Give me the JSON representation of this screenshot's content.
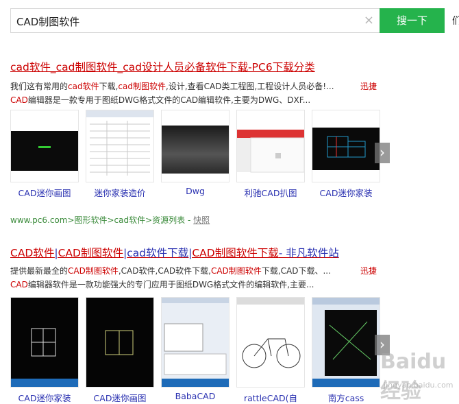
{
  "search": {
    "query": "CAD制图软件",
    "clear_glyph": "×",
    "button_label": "搜一下",
    "edge_fragment": "们"
  },
  "results": [
    {
      "title_parts": [
        "cad软件_cad制图软件_cad设计人员必备软件下载-PC6下载分类"
      ],
      "snippet1_parts": [
        "我们这有常用的",
        "cad软件",
        "下载,",
        "cad制图软件",
        ",设计,查看CAD类工程图,工程设计人员必备!..."
      ],
      "snippet2_parts": [
        "CAD",
        "编辑器是一款专用于图纸DWG格式文件的CAD编辑软件,主要为DWG、DXF..."
      ],
      "more_label": "迅捷",
      "thumbs": [
        "CAD迷你画图",
        "迷你家装造价",
        "Dwg",
        "利驰CAD扒图",
        "CAD迷你家装"
      ],
      "url_text": "www.pc6.com>图形软件>cad软件>资源列表 - ",
      "snapshot_label": "快照"
    },
    {
      "title_parts": [
        "CAD软件",
        "|",
        "CAD制图软件",
        "|",
        "cad软件下载",
        "|",
        "CAD制图软件下载",
        "- 非凡软件站"
      ],
      "snippet1_parts": [
        "提供最新最全的",
        "CAD制图软件",
        ",CAD软件,CAD软件下载,",
        "CAD制图软件",
        "下载,CAD下载、..."
      ],
      "snippet2_parts": [
        "CAD",
        "编辑器软件是一款功能强大的专门应用于图纸DWG格式文件的编辑软件,主要..."
      ],
      "more_label": "迅捷",
      "thumbs": [
        "CAD迷你家装",
        "CAD迷你画图",
        "BabaCAD",
        "rattleCAD(自",
        "南方cass"
      ]
    }
  ],
  "watermark": {
    "text": "Baidu经验",
    "url": "jingyan.baidu.com"
  },
  "colors": {
    "accent_green": "#25b34c",
    "link_red": "#cc0000",
    "link_blue": "#2a31b1",
    "url_green": "#3b8b3b"
  }
}
